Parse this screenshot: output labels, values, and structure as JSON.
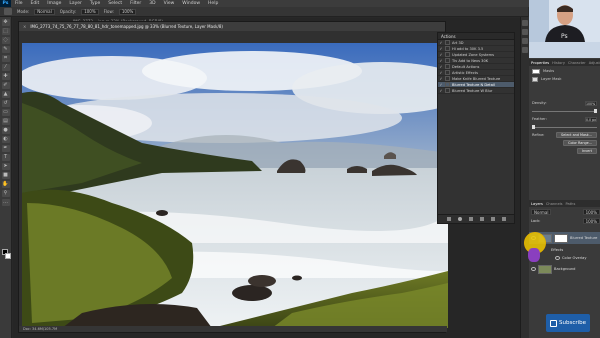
{
  "app": {
    "logo_text": "Ps",
    "menu": [
      "File",
      "Edit",
      "Image",
      "Layer",
      "Type",
      "Select",
      "Filter",
      "3D",
      "View",
      "Window",
      "Help"
    ]
  },
  "options_bar": {
    "mode_label": "Mode:",
    "mode_value": "Normal",
    "opacity_label": "Opacity:",
    "opacity_value": "100%",
    "flow_label": "Flow:",
    "flow_value": "100%"
  },
  "document": {
    "tab_title": "IMG_2773_74_75_76_77_78_80_81_hdr_tonemapped.jpg @ 33% (Blurred Texture, Layer Mask/8)",
    "background_window_title": "IMG_2773 ...jpg @ 33% (Background, RGB/8)",
    "status": "Doc: 34.6M/105.7M",
    "colors": {
      "sky": "#3e6fc0",
      "sea": "#dfe6ea",
      "grass": "#5b6a1e"
    }
  },
  "actions_panel": {
    "title": "Actions",
    "items": [
      {
        "label": "Art 3D",
        "selected": false
      },
      {
        "label": "Hi add to 30K 3.5",
        "selected": false
      },
      {
        "label": "Updated Zone Systems",
        "selected": false
      },
      {
        "label": "Tiv Add to Nexs 30K",
        "selected": false
      },
      {
        "label": "Default Actions",
        "selected": false
      },
      {
        "label": "Artistic Effects",
        "selected": false
      },
      {
        "label": "Make Knife Blurred Texture",
        "selected": false
      },
      {
        "label": "Blurred Texture N Detail",
        "selected": true
      },
      {
        "label": "Blurred Texture W Blur",
        "selected": false
      }
    ]
  },
  "right_panels": {
    "top_tabs": [
      "Properties",
      "History",
      "Character",
      "Adjust"
    ],
    "properties": {
      "title": "Masks",
      "layer_mask_label": "Layer Mask",
      "density_label": "Density:",
      "density_value": "100%",
      "density_level": 1.0,
      "feather_label": "Feather:",
      "feather_value": "0.0 px",
      "feather_level": 0.0,
      "refine_label": "Refine:",
      "select_mask_button": "Select and Mask...",
      "color_range_button": "Color Range...",
      "invert_button": "Invert"
    },
    "layers_tabs": [
      "Layers",
      "Channels",
      "Paths"
    ],
    "layers": {
      "blend_mode": "Normal",
      "opacity": "100%",
      "lock_label": "Lock:",
      "fill": "100%",
      "items": [
        {
          "name": "Blurred Texture"
        },
        {
          "name": "Effects"
        },
        {
          "name": "Color Overlay"
        },
        {
          "name": "Background"
        }
      ]
    }
  },
  "overlay": {
    "subscribe_label": "Subscribe"
  }
}
